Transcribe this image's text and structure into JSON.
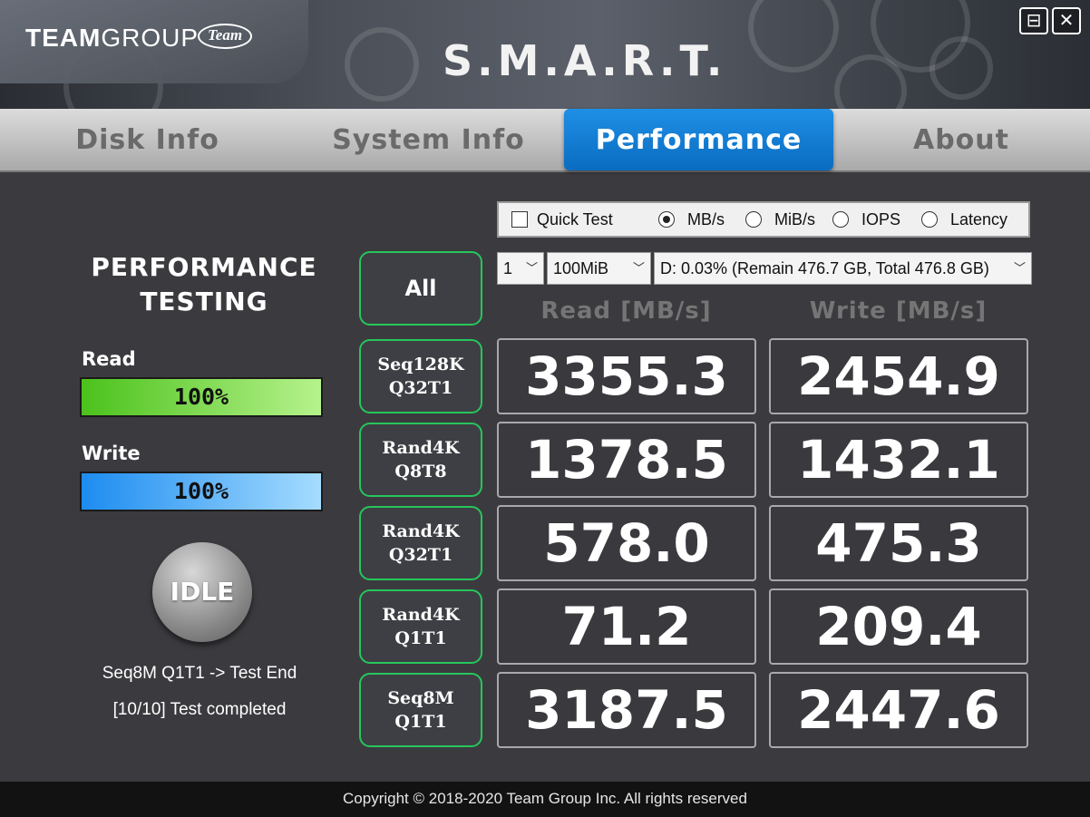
{
  "header": {
    "brand": "TEAMGROUP",
    "brand_team": "TEAM",
    "brand_group": "GROUP",
    "brand_badge": "Team",
    "title": "S.M.A.R.T."
  },
  "window_controls": {
    "restore": "⊟",
    "close": "✕"
  },
  "tabs": [
    {
      "label": "Disk Info",
      "active": false
    },
    {
      "label": "System Info",
      "active": false
    },
    {
      "label": "Performance",
      "active": true
    },
    {
      "label": "About",
      "active": false
    }
  ],
  "left_panel": {
    "title_line1": "PERFORMANCE",
    "title_line2": "TESTING",
    "read_label": "Read",
    "read_progress": "100%",
    "read_fraction": 1.0,
    "write_label": "Write",
    "write_progress": "100%",
    "write_fraction": 1.0,
    "idle_button": "IDLE",
    "status_line1": "Seq8M Q1T1 -> Test End",
    "status_line2": "[10/10] Test completed"
  },
  "options": {
    "quick_test": "Quick Test",
    "quick_test_checked": false,
    "units": [
      "MB/s",
      "MiB/s",
      "IOPS",
      "Latency"
    ],
    "selected_unit": "MB/s"
  },
  "selectors": {
    "count": "1",
    "size": "100MiB",
    "drive": "D: 0.03% (Remain 476.7 GB, Total 476.8 GB)"
  },
  "columns": {
    "read": "Read [MB/s]",
    "write": "Write [MB/s]"
  },
  "all_button": "All",
  "tests": [
    {
      "line1": "Seq128K",
      "line2": "Q32T1",
      "read": "3355.3",
      "write": "2454.9"
    },
    {
      "line1": "Rand4K",
      "line2": "Q8T8",
      "read": "1378.5",
      "write": "1432.1"
    },
    {
      "line1": "Rand4K",
      "line2": "Q32T1",
      "read": "578.0",
      "write": "475.3"
    },
    {
      "line1": "Rand4K",
      "line2": "Q1T1",
      "read": "71.2",
      "write": "209.4"
    },
    {
      "line1": "Seq8M",
      "line2": "Q1T1",
      "read": "3187.5",
      "write": "2447.6"
    }
  ],
  "footer": "Copyright © 2018-2020 Team Group Inc. All rights reserved"
}
